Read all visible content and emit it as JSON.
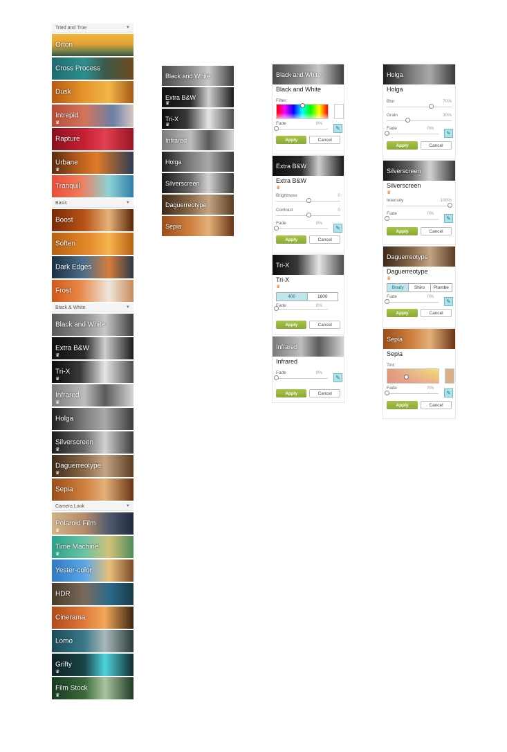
{
  "sidebar": {
    "sections": [
      {
        "title": "Tried and True",
        "items": [
          {
            "label": "Orton",
            "bg": "linear-gradient(180deg,#f3b63a 0%,#e2a235 45%,#6d7f4a 80%,#3b4d3a 100%)",
            "crown": false
          },
          {
            "label": "Cross Process",
            "bg": "linear-gradient(90deg,#1f6b72 0%,#2d8f8e 40%,#3d5a4b 65%,#6e4a1f 100%)",
            "crown": false
          },
          {
            "label": "Dusk",
            "bg": "linear-gradient(90deg,#b85a12 0%,#e6952c 40%,#f2b548 70%,#a45a16 100%)",
            "crown": false
          },
          {
            "label": "Intrepid",
            "bg": "linear-gradient(90deg,#b74a37 0%,#d3745a 40%,#6b7fa6 75%,#d9c7c3 100%)",
            "crown": true
          },
          {
            "label": "Rapture",
            "bg": "linear-gradient(90deg,#8b0f1e 0%,#c72034 40%,#e04050 65%,#9a1424 100%)",
            "crown": false
          },
          {
            "label": "Urbane",
            "bg": "linear-gradient(90deg,#5a2a0e 0%,#b05a1c 30%,#e07a28 55%,#2b3b55 100%)",
            "crown": true
          },
          {
            "label": "Tranquil",
            "bg": "linear-gradient(90deg,#e94d3a 0%,#f27b59 35%,#8dd3d6 70%,#2e7ea7 100%)",
            "crown": false
          }
        ]
      },
      {
        "title": "Basic",
        "items": [
          {
            "label": "Boost",
            "bg": "linear-gradient(90deg,#7a2a06 0%,#b8531a 40%,#e5b27a 70%,#5a2408 100%)",
            "crown": false
          },
          {
            "label": "Soften",
            "bg": "linear-gradient(90deg,#b86012 0%,#e58a2a 45%,#f7b251 70%,#b86012 100%)",
            "crown": false
          },
          {
            "label": "Dark Edges",
            "bg": "linear-gradient(90deg,#1a3044 0%,#4f6f8b 40%,#d77d3b 70%,#2a3846 100%)",
            "crown": false
          },
          {
            "label": "Frost",
            "bg": "linear-gradient(90deg,#d2581a 0%,#e68a4a 35%,#efe6dc 70%,#c98a5a 100%)",
            "crown": false
          }
        ]
      },
      {
        "title": "Black & White",
        "items": [
          {
            "label": "Black and White",
            "bg": "linear-gradient(90deg,#5b5b5b 0%,#8d8d8d 40%,#c9c9c9 65%,#3d3d3d 100%)",
            "crown": false
          },
          {
            "label": "Extra B&W",
            "bg": "linear-gradient(90deg,#0f0f0f 0%,#2a2a2a 40%,#cfcfcf 65%,#1a1a1a 100%)",
            "crown": true
          },
          {
            "label": "Tri-X",
            "bg": "linear-gradient(90deg,#0c0c0c 0%,#3a3a3a 35%,#e6e6e6 65%,#4d4d4d 100%)",
            "crown": true
          },
          {
            "label": "Infrared",
            "bg": "linear-gradient(90deg,#7a7a7a 0%,#bdbdbd 40%,#5a5a5a 65%,#d6d6d6 100%)",
            "crown": true
          },
          {
            "label": "Holga",
            "bg": "linear-gradient(90deg,#1e1e1e 0%,#7e7e7e 40%,#a9a9a9 65%,#3a3a3a 100%)",
            "crown": false
          },
          {
            "label": "Silverscreen",
            "bg": "linear-gradient(90deg,#1a1a1a 0%,#6a6a6a 40%,#d2d2d2 65%,#3a3a3a 100%)",
            "crown": true
          },
          {
            "label": "Daguerreotype",
            "bg": "linear-gradient(90deg,#3d2a1a 0%,#8a6a4a 40%,#c4a483 65%,#5a3c22 100%)",
            "crown": true
          },
          {
            "label": "Sepia",
            "bg": "linear-gradient(90deg,#9a4e1a 0%,#d08040 40%,#e4b07a 65%,#6a3414 100%)",
            "crown": false
          }
        ]
      },
      {
        "title": "Camera Look",
        "items": [
          {
            "label": "Polaroid Film",
            "bg": "linear-gradient(90deg,#d0b48a 0%,#b58c6a 40%,#4f5a6e 70%,#1f2a3c 100%)",
            "crown": true
          },
          {
            "label": "Time Machine",
            "bg": "linear-gradient(90deg,#2aa08c 0%,#6ac4a4 40%,#d2c27a 70%,#4e8a5a 100%)",
            "crown": true
          },
          {
            "label": "Yester-color",
            "bg": "linear-gradient(90deg,#2f7ac4 0%,#5aa6e6 40%,#e8c07a 70%,#7a4a2a 100%)",
            "crown": false
          },
          {
            "label": "HDR",
            "bg": "linear-gradient(90deg,#4a3a2a 0%,#7a6a5a 40%,#2a6a8a 70%,#1a3a4a 100%)",
            "crown": false
          },
          {
            "label": "Cinerama",
            "bg": "linear-gradient(90deg,#b04a1a 0%,#e07a3a 40%,#f2a85a 65%,#3a2410 100%)",
            "crown": false
          },
          {
            "label": "Lomo",
            "bg": "linear-gradient(90deg,#1a4a5a 0%,#3a7a8a 40%,#a9b8b8 65%,#2a3a3a 100%)",
            "crown": false
          },
          {
            "label": "Grifty",
            "bg": "linear-gradient(90deg,#102224 0%,#1a4448 40%,#4fd4dc 65%,#0e2a2c 100%)",
            "crown": true
          },
          {
            "label": "Film Stock",
            "bg": "linear-gradient(90deg,#183a22 0%,#3a6a3a 40%,#a9c4a0 65%,#1e3a24 100%)",
            "crown": true
          }
        ]
      }
    ]
  },
  "bw_list": {
    "items": [
      {
        "label": "Black and White",
        "bg": "linear-gradient(90deg,#4a4a4a 0%,#8d8d8d 40%,#c9c9c9 65%,#3d3d3d 100%)",
        "crown": false
      },
      {
        "label": "Extra B&W",
        "bg": "linear-gradient(90deg,#0f0f0f 0%,#2a2a2a 40%,#cfcfcf 65%,#1a1a1a 100%)",
        "crown": true
      },
      {
        "label": "Tri-X",
        "bg": "linear-gradient(90deg,#0c0c0c 0%,#3a3a3a 35%,#e6e6e6 65%,#4d4d4d 100%)",
        "crown": true
      },
      {
        "label": "Infrared",
        "bg": "linear-gradient(90deg,#7a7a7a 0%,#bdbdbd 40%,#5a5a5a 65%,#d6d6d6 100%)",
        "crown": false
      },
      {
        "label": "Holga",
        "bg": "linear-gradient(90deg,#1e1e1e 0%,#7e7e7e 40%,#a9a9a9 65%,#3a3a3a 100%)",
        "crown": false
      },
      {
        "label": "Silverscreen",
        "bg": "linear-gradient(90deg,#1a1a1a 0%,#6a6a6a 40%,#d2d2d2 65%,#3a3a3a 100%)",
        "crown": false
      },
      {
        "label": "Daguerreotype",
        "bg": "linear-gradient(90deg,#3d2a1a 0%,#8a6a4a 40%,#c4a483 65%,#5a3c22 100%)",
        "crown": false
      },
      {
        "label": "Sepia",
        "bg": "linear-gradient(90deg,#9a4e1a 0%,#d08040 40%,#e4b07a 65%,#6a3414 100%)",
        "crown": false
      }
    ]
  },
  "panels": {
    "bw": {
      "header": "Black and White",
      "title": "Black and White",
      "filter_label": "Filter:",
      "fade_label": "Fade",
      "fade_value": "0%",
      "fade": 0,
      "filter_pos": 0.45
    },
    "extra": {
      "header": "Extra B&W",
      "title": "Extra B&W",
      "brightness_label": "Brightness",
      "brightness_value": "0",
      "brightness": 0.5,
      "contrast_label": "Contrast",
      "contrast_value": "0",
      "contrast": 0.5,
      "fade_label": "Fade",
      "fade_value": "0%",
      "fade": 0
    },
    "trix": {
      "header": "Tri-X",
      "title": "Tri-X",
      "options": [
        "400",
        "1600"
      ],
      "selected": 0,
      "fade_label": "Fade",
      "fade_value": "0%",
      "fade": 0
    },
    "infrared": {
      "header": "Infrared",
      "title": "Infrared",
      "fade_label": "Fade",
      "fade_value": "0%",
      "fade": 0
    },
    "holga": {
      "header": "Holga",
      "title": "Holga",
      "blur_label": "Blur",
      "blur_value": "70%",
      "blur": 0.7,
      "grain_label": "Grain",
      "grain_value": "30%",
      "grain": 0.3,
      "fade_label": "Fade",
      "fade_value": "0%",
      "fade": 0
    },
    "silver": {
      "header": "Silverscreen",
      "title": "Silverscreen",
      "intensity_label": "Intensity",
      "intensity_value": "100%",
      "intensity": 1.0,
      "fade_label": "Fade",
      "fade_value": "0%",
      "fade": 0
    },
    "dag": {
      "header": "Daguerreotype",
      "title": "Daguerreotype",
      "options": [
        "Brady",
        "Shiro",
        "Plumbe"
      ],
      "selected": 0,
      "fade_label": "Fade",
      "fade_value": "0%",
      "fade": 0
    },
    "sepia": {
      "header": "Sepia",
      "title": "Sepia",
      "tint_label": "Tint:",
      "fade_label": "Fade",
      "fade_value": "0%",
      "fade": 0
    }
  },
  "buttons": {
    "apply": "Apply",
    "cancel": "Cancel"
  },
  "icons": {
    "crown": "crown-icon",
    "caret": "caret-down-icon",
    "brush": "brush-icon"
  },
  "colors": {
    "apply": "#9ab63e",
    "crown_orange": "#e07820",
    "brush": "#aee3ea"
  }
}
